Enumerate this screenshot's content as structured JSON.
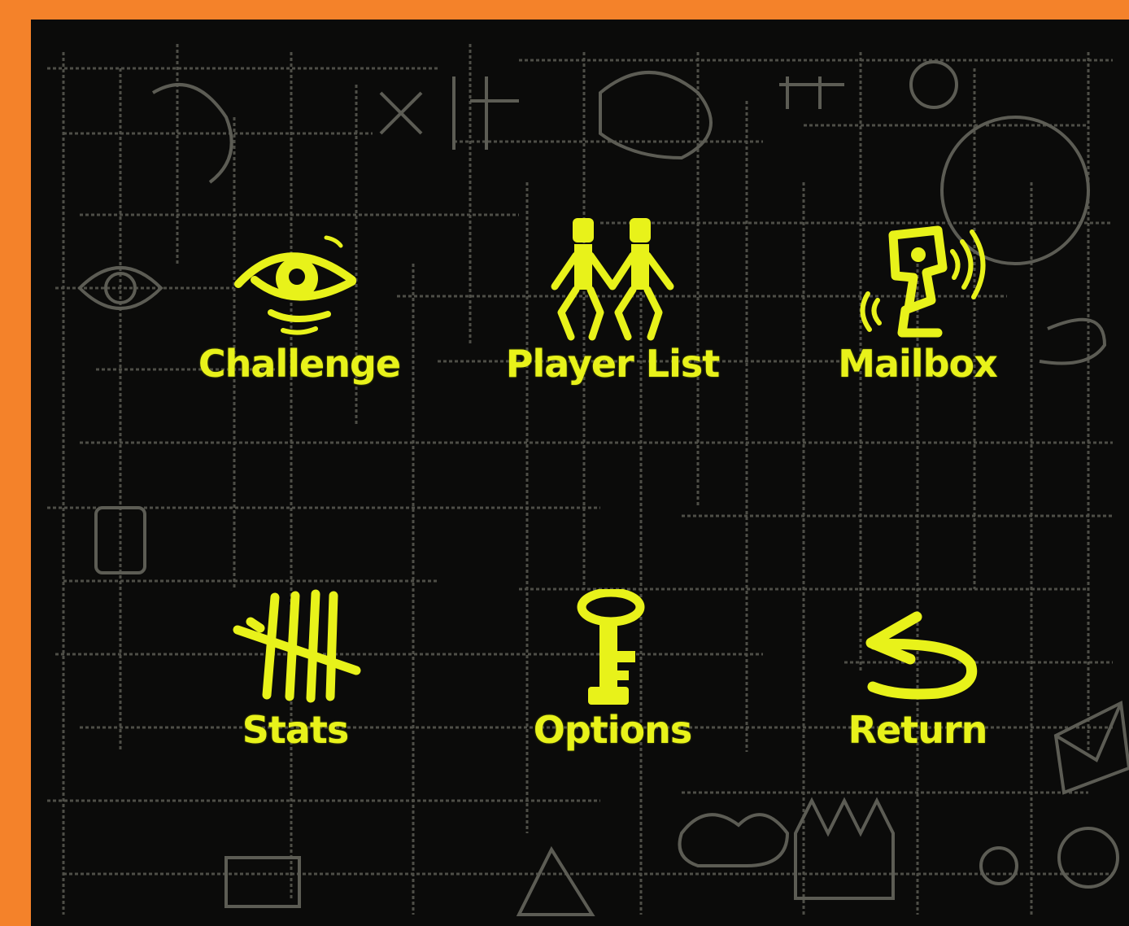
{
  "menu": {
    "items": [
      {
        "label": "Challenge",
        "icon": "eye-icon"
      },
      {
        "label": "Player List",
        "icon": "two-people-icon"
      },
      {
        "label": "Mailbox",
        "icon": "mailbox-speaker-icon"
      },
      {
        "label": "Stats",
        "icon": "tally-marks-icon"
      },
      {
        "label": "Options",
        "icon": "key-icon"
      },
      {
        "label": "Return",
        "icon": "return-arrow-icon"
      }
    ]
  },
  "colors": {
    "border": "#f4822a",
    "background": "#0b0b0a",
    "accent": "#e8f21a",
    "pattern": "#5c5c54"
  }
}
